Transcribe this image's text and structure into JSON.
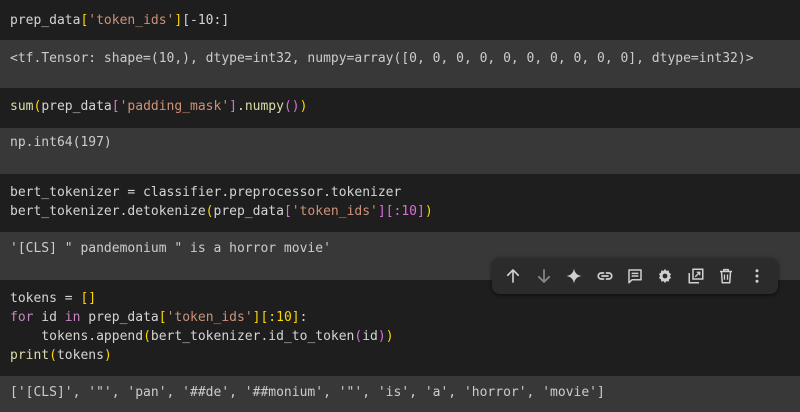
{
  "cells": [
    {
      "code": [
        "prep_data",
        "[",
        "'token_ids'",
        "]",
        "[-10:]"
      ],
      "output": "<tf.Tensor: shape=(10,), dtype=int32, numpy=array([0, 0, 0, 0, 0, 0, 0, 0, 0, 0], dtype=int32)>"
    },
    {
      "code": [
        "sum",
        "(",
        "prep_data",
        "[",
        "'padding_mask'",
        "]",
        ".numpy",
        "()",
        ")"
      ],
      "output": "np.int64(197)"
    },
    {
      "code_lines": [
        "bert_tokenizer = classifier.preprocessor.tokenizer",
        [
          "bert_tokenizer.detokenize",
          "(",
          "prep_data",
          "[",
          "'token_ids'",
          "]",
          "[:10]",
          ")"
        ]
      ],
      "output": "'[CLS] \" pandemonium \" is a horror movie'"
    },
    {
      "code_lines": [
        [
          "tokens = ",
          "[]"
        ],
        [
          "for",
          " id ",
          "in",
          " prep_data",
          "[",
          "'token_ids'",
          "]",
          "[:10]",
          ":"
        ],
        [
          "    tokens.append",
          "(",
          "bert_tokenizer.id_to_token",
          "(",
          "id",
          ")",
          ")"
        ],
        [
          "print",
          "(",
          "tokens",
          ")"
        ]
      ],
      "output": "['[CLS]', '\"', 'pan', '##de', '##monium', '\"', 'is', 'a', 'horror', 'movie']"
    }
  ],
  "toolbar": {
    "icons": [
      "arrow-up-icon",
      "arrow-down-icon",
      "sparkle-icon",
      "link-icon",
      "comment-icon",
      "gear-icon",
      "mirror-cell-icon",
      "trash-icon",
      "more-vert-icon"
    ]
  }
}
